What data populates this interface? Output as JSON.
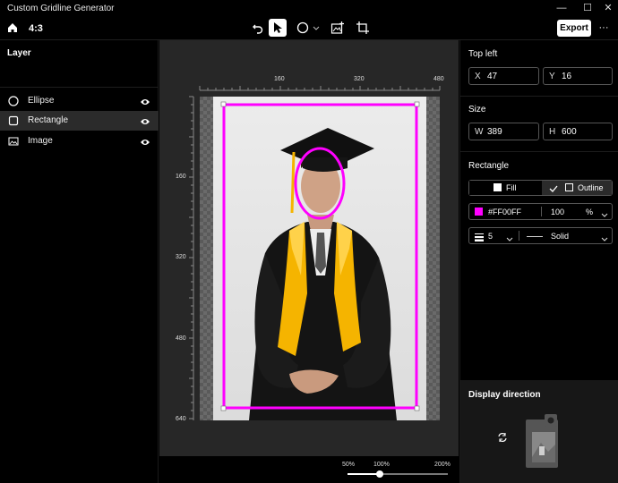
{
  "app": {
    "title": "Custom Gridline Generator"
  },
  "window_controls": {
    "minimize": "—",
    "maximize": "☐",
    "close": "✕"
  },
  "toolbar": {
    "aspect_ratio": "4:3",
    "export_label": "Export",
    "more_label": "···",
    "icons": [
      "home-icon",
      "undo-icon",
      "pointer-icon",
      "ellipse-tool-icon",
      "chevron-down-icon",
      "add-image-icon",
      "crop-icon",
      "more-icon"
    ]
  },
  "layers": {
    "title": "Layer",
    "items": [
      {
        "name": "Ellipse",
        "icon": "circle-icon",
        "selected": false
      },
      {
        "name": "Rectangle",
        "icon": "square-icon",
        "selected": true
      },
      {
        "name": "Image",
        "icon": "image-icon",
        "selected": false
      }
    ]
  },
  "ruler": {
    "top_labels": [
      "160",
      "320",
      "480"
    ],
    "left_labels": [
      "160",
      "320",
      "480",
      "640"
    ]
  },
  "zoom": {
    "min_label": "50%",
    "mid_label": "100%",
    "max_label": "200%",
    "value_percent": 100
  },
  "properties": {
    "top_left": {
      "title": "Top left",
      "x_label": "X",
      "x_value": "47",
      "y_label": "Y",
      "y_value": "16"
    },
    "size": {
      "title": "Size",
      "w_label": "W",
      "w_value": "389",
      "h_label": "H",
      "h_value": "600"
    },
    "rectangle": {
      "title": "Rectangle",
      "fill_label": "Fill",
      "outline_label": "Outline",
      "outline_checked": true,
      "color_hex": "#FF00FF",
      "color_label": "#FF00FF",
      "opacity_value": "100",
      "opacity_unit": "%",
      "stroke_width": "5",
      "stroke_style": "Solid"
    },
    "display_direction": {
      "title": "Display direction"
    }
  },
  "colors": {
    "accent": "#ff00ff",
    "panel": "#000000",
    "canvas": "#272727",
    "selected_row": "#2b2b2b"
  }
}
